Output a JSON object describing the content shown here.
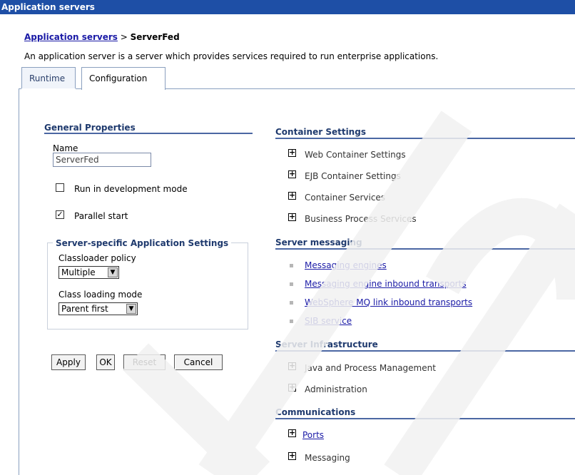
{
  "window": {
    "title": "Application servers"
  },
  "breadcrumb": {
    "link": "Application servers",
    "separator": " > ",
    "current": "ServerFed"
  },
  "description": "An application server is a server which provides services required to run enterprise applications.",
  "tabs": [
    {
      "label": "Runtime"
    },
    {
      "label": "Configuration"
    }
  ],
  "general": {
    "heading": "General Properties",
    "name_label": "Name",
    "name_value": "ServerFed",
    "dev_mode_label": "Run in development mode",
    "dev_mode_checked": false,
    "parallel_label": "Parallel start",
    "parallel_checked": true,
    "server_specific": {
      "legend": "Server-specific Application Settings",
      "classloader_label": "Classloader policy",
      "classloader_value": "Multiple",
      "loading_label": "Class loading mode",
      "loading_value": "Parent first"
    },
    "buttons": {
      "apply": "Apply",
      "ok": "OK",
      "reset": "Reset",
      "cancel": "Cancel"
    }
  },
  "container_settings": {
    "heading": "Container Settings",
    "items": [
      "Web Container Settings",
      "EJB Container Settings",
      "Container Services",
      "Business Process Services"
    ]
  },
  "server_messaging": {
    "heading": "Server messaging",
    "items": [
      "Messaging engines",
      "Messaging engine inbound transports",
      "WebSphere MQ link inbound transports",
      "SIB service"
    ]
  },
  "server_infrastructure": {
    "heading": "Server Infrastructure",
    "items": [
      "Java and Process Management",
      "Administration"
    ]
  },
  "communications": {
    "heading": "Communications",
    "items": [
      "Ports",
      "Messaging"
    ]
  },
  "icons": {
    "expand": "plus-box-icon",
    "checkbox_mark": "check-icon",
    "bullet": "square-bullet-icon"
  },
  "colors": {
    "titlebar": "#1e4fa6",
    "link": "#1a1aa6",
    "section_heading": "#1f3a6e",
    "section_rule": "#4b67a3"
  }
}
